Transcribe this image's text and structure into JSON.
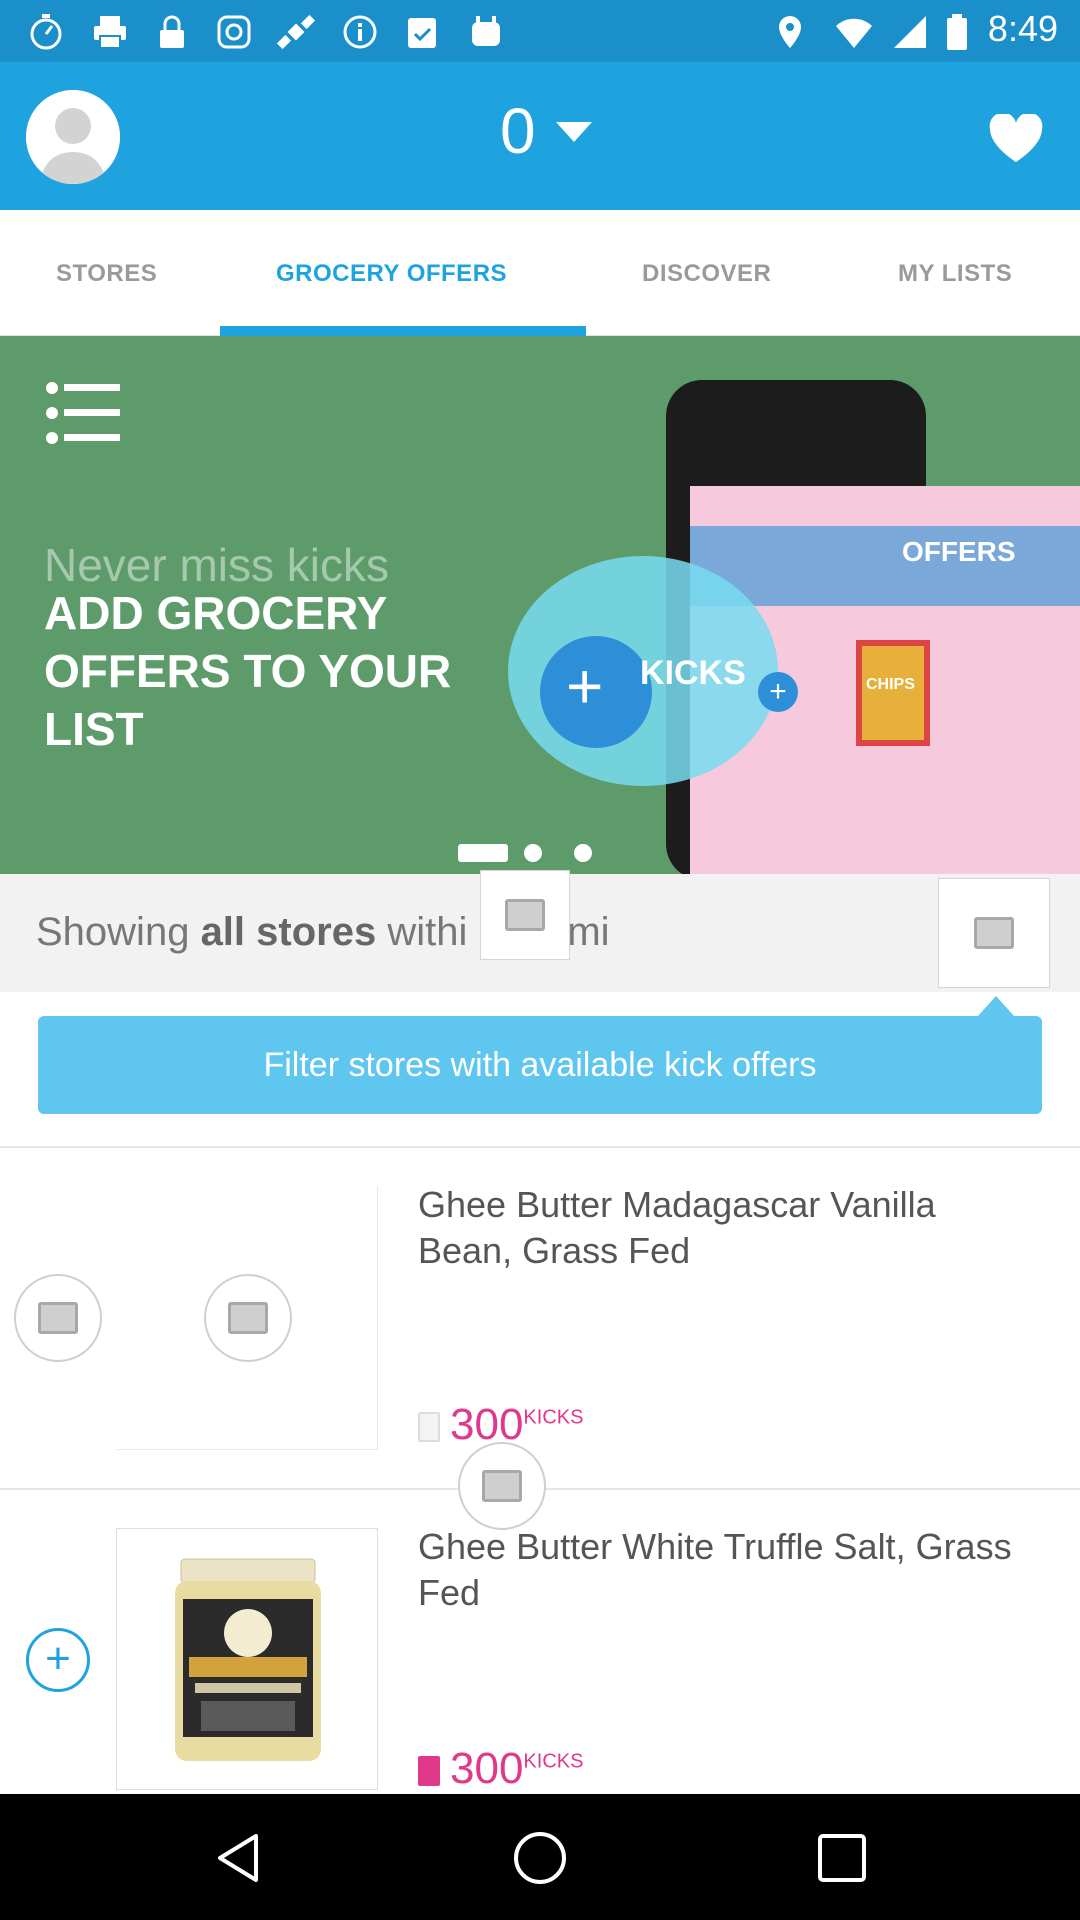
{
  "status_bar": {
    "time": "8:49"
  },
  "header": {
    "kicks_count": "0"
  },
  "tabs": [
    {
      "label": "STORES",
      "active": false
    },
    {
      "label": "GROCERY OFFERS",
      "active": true
    },
    {
      "label": "DISCOVER",
      "active": false
    },
    {
      "label": "MY LISTS",
      "active": false
    }
  ],
  "banner": {
    "faded_text": "Never miss kicks",
    "headline": "ADD GROCERY OFFERS TO YOUR LIST",
    "phone_offers_label": "OFFERS",
    "kicks_badge_label": "KICKS",
    "chips_label": "CHIPS",
    "page_count": 3,
    "active_page": 1
  },
  "showing": {
    "prefix": "Showing ",
    "bold": "all stores",
    "suffix": " withi",
    "unit": "mi"
  },
  "filter": {
    "label": "Filter stores with available kick offers"
  },
  "products": [
    {
      "title": "Ghee Butter Madagascar Vanilla Bean, Grass Fed",
      "kicks": "300",
      "kicks_unit": "KICKS"
    },
    {
      "title": "Ghee Butter White Truffle Salt, Grass Fed",
      "kicks": "300",
      "kicks_unit": "KICKS"
    }
  ],
  "colors": {
    "app_bar": "#1fa3de",
    "accent_pink": "#e0388b",
    "filter_button": "#5fc6f0",
    "banner_green": "#5d9b6a"
  }
}
